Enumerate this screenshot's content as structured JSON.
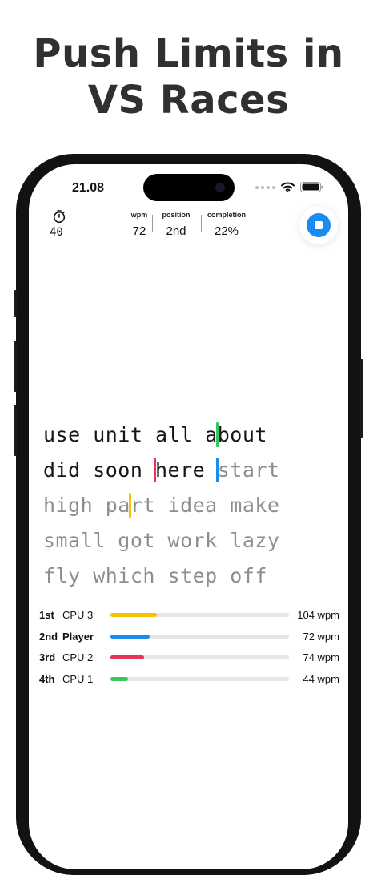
{
  "headline": {
    "line1": "Push Limits in",
    "line2": "VS Races"
  },
  "status_bar": {
    "time": "21.08"
  },
  "stats": {
    "timer": "40",
    "wpm_label": "wpm",
    "wpm_value": "72",
    "position_label": "position",
    "position_value": "2nd",
    "completion_label": "completion",
    "completion_value": "22%"
  },
  "typing": {
    "lines": [
      {
        "typed": "use unit all about",
        "pending": ""
      },
      {
        "typed": "did soon here ",
        "pending": "start"
      },
      {
        "typed": "",
        "pending": "high part idea make"
      },
      {
        "typed": "",
        "pending": "small got work lazy"
      },
      {
        "typed": "",
        "pending": "fly which step off"
      }
    ]
  },
  "race": [
    {
      "place": "1st",
      "name": "CPU 3",
      "wpm": "104 wpm",
      "progress": 0.26,
      "color": "#f5c400",
      "is_player": false
    },
    {
      "place": "2nd",
      "name": "Player",
      "wpm": "72 wpm",
      "progress": 0.22,
      "color": "#1a8cf0",
      "is_player": true
    },
    {
      "place": "3rd",
      "name": "CPU 2",
      "wpm": "74 wpm",
      "progress": 0.19,
      "color": "#e8345a",
      "is_player": false
    },
    {
      "place": "4th",
      "name": "CPU 1",
      "wpm": "44 wpm",
      "progress": 0.1,
      "color": "#34c759",
      "is_player": false
    }
  ],
  "cursors": [
    {
      "racer": "CPU 3",
      "line": 0,
      "char": 14,
      "color": "#34c759"
    },
    {
      "racer": "CPU 2",
      "line": 1,
      "char": 9,
      "color": "#e8345a"
    },
    {
      "racer": "Player",
      "line": 1,
      "char": 14,
      "color": "#1a8cf0"
    },
    {
      "racer": "CPU 1",
      "line": 2,
      "char": 7,
      "color": "#f5c400"
    }
  ],
  "icons": {
    "timer": "stopwatch-icon",
    "stop": "stop-icon",
    "wifi": "wifi-icon",
    "battery": "battery-icon"
  }
}
